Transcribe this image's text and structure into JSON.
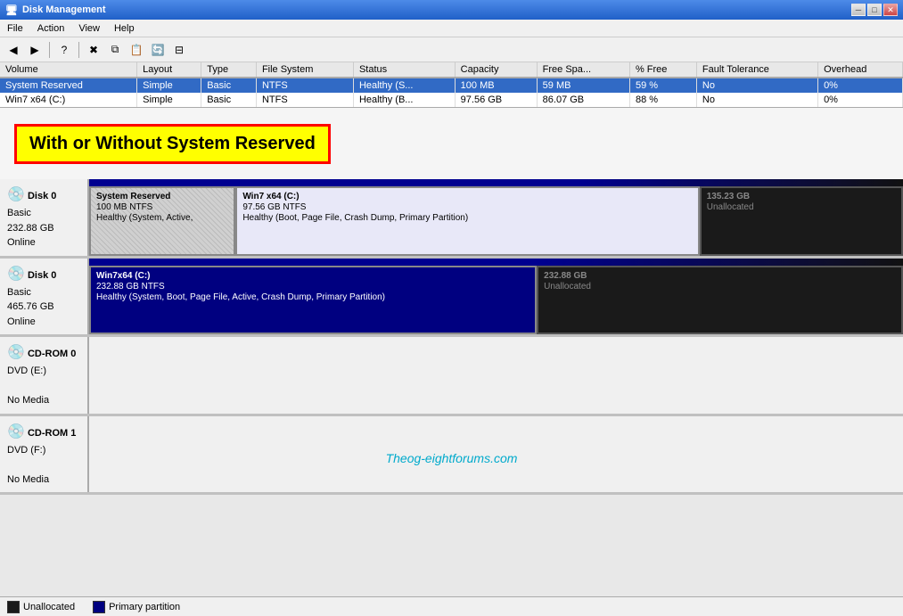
{
  "titleBar": {
    "title": "Disk Management",
    "controls": [
      "minimize",
      "restore",
      "close"
    ]
  },
  "menuBar": {
    "items": [
      "File",
      "Action",
      "View",
      "Help"
    ]
  },
  "toolbar": {
    "buttons": [
      "←",
      "→",
      "⊡",
      "?",
      "✖",
      "⎘",
      "⎙",
      "🔄",
      "⊟"
    ]
  },
  "volumeTable": {
    "columns": [
      "Volume",
      "Layout",
      "Type",
      "File System",
      "Status",
      "Capacity",
      "Free Spa...",
      "% Free",
      "Fault Tolerance",
      "Overhead"
    ],
    "rows": [
      {
        "volume": "System Reserved",
        "layout": "Simple",
        "type": "Basic",
        "fileSystem": "NTFS",
        "status": "Healthy (S...",
        "capacity": "100 MB",
        "freeSpace": "59 MB",
        "percentFree": "59 %",
        "faultTolerance": "No",
        "overhead": "0%",
        "selected": true
      },
      {
        "volume": "Win7 x64 (C:)",
        "layout": "Simple",
        "type": "Basic",
        "fileSystem": "NTFS",
        "status": "Healthy (B...",
        "capacity": "97.56 GB",
        "freeSpace": "86.07 GB",
        "percentFree": "88 %",
        "faultTolerance": "No",
        "overhead": "0%",
        "selected": false
      }
    ]
  },
  "annotation": {
    "text": "With or Without  System Reserved"
  },
  "disks": [
    {
      "id": "disk0-with",
      "label": "Disk 0",
      "type": "Basic",
      "size": "232.88 GB",
      "status": "Online",
      "icon": "💿",
      "partitions": [
        {
          "kind": "system-reserved",
          "title": "System Reserved",
          "sub1": "100 MB NTFS",
          "sub2": "Healthy (System, Active,",
          "width": "18%"
        },
        {
          "kind": "primary",
          "title": "Win7 x64 (C:)",
          "sub1": "97.56 GB NTFS",
          "sub2": "Healthy (Boot, Page File, Crash Dump, Primary Partition)",
          "width": "57%"
        },
        {
          "kind": "unallocated",
          "title": "135.23 GB",
          "sub1": "Unallocated",
          "sub2": "",
          "width": "25%"
        }
      ]
    },
    {
      "id": "disk0-without",
      "label": "Disk 0",
      "type": "Basic",
      "size": "465.76 GB",
      "status": "Online",
      "icon": "💿",
      "partitions": [
        {
          "kind": "dark-primary",
          "title": "Win7x64  (C:)",
          "sub1": "232.88 GB NTFS",
          "sub2": "Healthy (System, Boot, Page File, Active, Crash Dump, Primary Partition)",
          "width": "55%"
        },
        {
          "kind": "unallocated",
          "title": "232.88 GB",
          "sub1": "Unallocated",
          "sub2": "",
          "width": "45%"
        }
      ]
    },
    {
      "id": "cdrom0",
      "label": "CD-ROM 0",
      "type": "DVD (E:)",
      "size": "",
      "status": "No Media",
      "icon": "💿",
      "partitions": []
    },
    {
      "id": "cdrom1",
      "label": "CD-ROM 1",
      "type": "DVD (F:)",
      "size": "",
      "status": "No Media",
      "icon": "💿",
      "partitions": []
    }
  ],
  "statusBar": {
    "legend": [
      {
        "label": "Unallocated",
        "color": "#1a1a1a"
      },
      {
        "label": "Primary partition",
        "color": "#000080"
      }
    ]
  },
  "watermark": {
    "text": "Theog-eightforums.com"
  }
}
